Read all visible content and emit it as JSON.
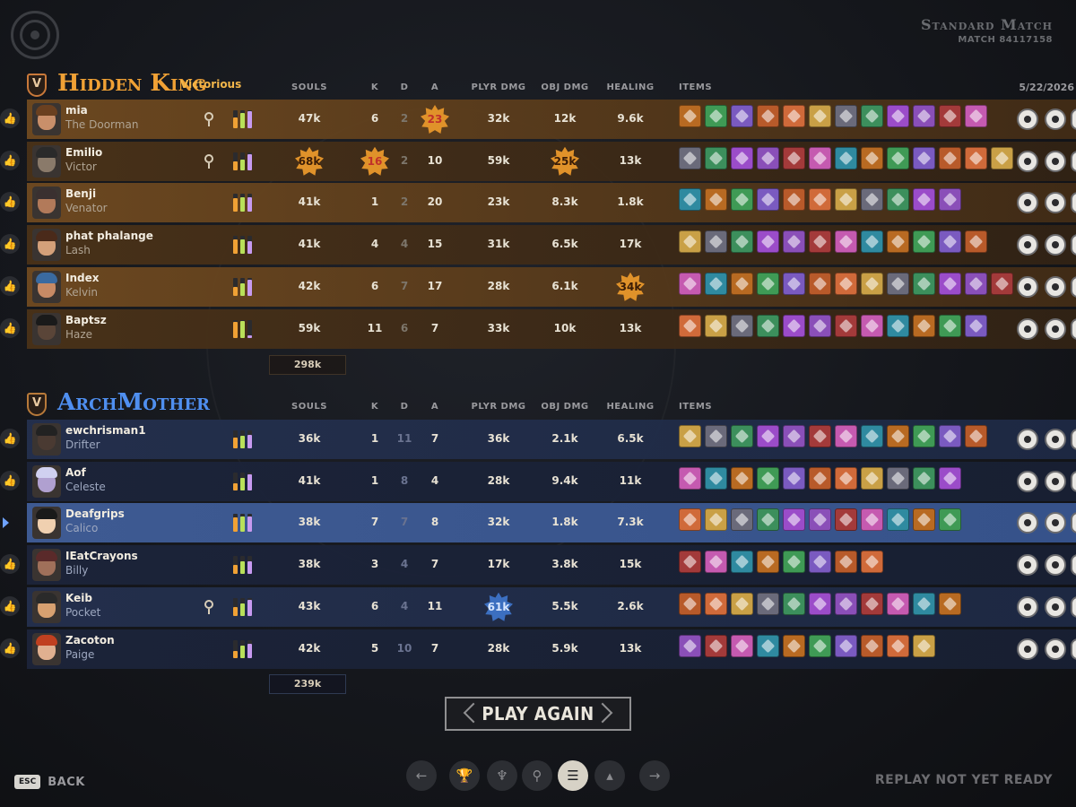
{
  "header": {
    "match_title": "Standard Match",
    "match_number": "MATCH 84117158",
    "date": "5/22/2026"
  },
  "columns": {
    "souls": "SOULS",
    "k": "K",
    "d": "D",
    "a": "A",
    "plyr_dmg": "PLYR DMG",
    "obj_dmg": "OBJ DMG",
    "healing": "HEALING",
    "items": "ITEMS"
  },
  "teams": [
    {
      "name": "Hidden King",
      "badge": "V",
      "status": "Victorious",
      "accent": "#f0a135",
      "total_souls": "298k",
      "players": [
        {
          "name": "mia",
          "hero": "The Doorman",
          "souls": "47k",
          "k": "6",
          "d": "2",
          "a": "23",
          "plyr_dmg": "32k",
          "obj_dmg": "12k",
          "healing": "9.6k",
          "highlight": "a",
          "role_icon": "keyhole-icon",
          "bars": [
            0.6,
            0.85,
            0.95
          ]
        },
        {
          "name": "Emilio",
          "hero": "Victor",
          "souls": "68k",
          "k": "16",
          "d": "2",
          "a": "10",
          "plyr_dmg": "59k",
          "obj_dmg": "25k",
          "healing": "13k",
          "highlight": "souls,k,obj_dmg",
          "role_icon": "sun-icon",
          "bars": [
            0.5,
            0.6,
            0.9
          ]
        },
        {
          "name": "Benji",
          "hero": "Venator",
          "souls": "41k",
          "k": "1",
          "d": "2",
          "a": "20",
          "plyr_dmg": "23k",
          "obj_dmg": "8.3k",
          "healing": "1.8k",
          "highlight": "",
          "role_icon": "",
          "bars": [
            0.75,
            0.8,
            0.8
          ]
        },
        {
          "name": "phat phalange",
          "hero": "Lash",
          "souls": "41k",
          "k": "4",
          "d": "4",
          "a": "15",
          "plyr_dmg": "31k",
          "obj_dmg": "6.5k",
          "healing": "17k",
          "highlight": "",
          "role_icon": "",
          "bars": [
            0.8,
            0.8,
            0.7
          ]
        },
        {
          "name": "Index",
          "hero": "Kelvin",
          "souls": "42k",
          "k": "6",
          "d": "7",
          "a": "17",
          "plyr_dmg": "28k",
          "obj_dmg": "6.1k",
          "healing": "34k",
          "highlight": "healing",
          "role_icon": "",
          "bars": [
            0.5,
            0.7,
            0.9
          ]
        },
        {
          "name": "Baptsz",
          "hero": "Haze",
          "souls": "59k",
          "k": "11",
          "d": "6",
          "a": "7",
          "plyr_dmg": "33k",
          "obj_dmg": "10k",
          "healing": "13k",
          "highlight": "",
          "role_icon": "",
          "bars": [
            0.9,
            0.95,
            0.15
          ]
        }
      ]
    },
    {
      "name": "ArchMother",
      "badge": "V",
      "status": "",
      "accent": "#4f8ff0",
      "total_souls": "239k",
      "players": [
        {
          "name": "ewchrisman1",
          "hero": "Drifter",
          "souls": "36k",
          "k": "1",
          "d": "11",
          "a": "7",
          "plyr_dmg": "36k",
          "obj_dmg": "2.1k",
          "healing": "6.5k",
          "highlight": "",
          "role_icon": "",
          "bars": [
            0.6,
            0.7,
            0.75
          ]
        },
        {
          "name": "Aof",
          "hero": "Celeste",
          "souls": "41k",
          "k": "1",
          "d": "8",
          "a": "4",
          "plyr_dmg": "28k",
          "obj_dmg": "9.4k",
          "healing": "11k",
          "highlight": "",
          "role_icon": "",
          "bars": [
            0.4,
            0.7,
            0.9
          ]
        },
        {
          "name": "Deafgrips",
          "hero": "Calico",
          "souls": "38k",
          "k": "7",
          "d": "7",
          "a": "8",
          "plyr_dmg": "32k",
          "obj_dmg": "1.8k",
          "healing": "7.3k",
          "highlight": "",
          "role_icon": "",
          "bars": [
            0.8,
            0.85,
            0.85
          ],
          "selected": true
        },
        {
          "name": "IEatCrayons",
          "hero": "Billy",
          "souls": "38k",
          "k": "3",
          "d": "4",
          "a": "7",
          "plyr_dmg": "17k",
          "obj_dmg": "3.8k",
          "healing": "15k",
          "highlight": "",
          "role_icon": "",
          "bars": [
            0.5,
            0.7,
            0.7
          ]
        },
        {
          "name": "Keib",
          "hero": "Pocket",
          "souls": "43k",
          "k": "6",
          "d": "4",
          "a": "11",
          "plyr_dmg": "61k",
          "obj_dmg": "5.5k",
          "healing": "2.6k",
          "highlight": "plyr_dmg",
          "role_icon": "keyhole-icon",
          "bars": [
            0.5,
            0.7,
            0.9
          ]
        },
        {
          "name": "Zacoton",
          "hero": "Paige",
          "souls": "42k",
          "k": "5",
          "d": "10",
          "a": "7",
          "plyr_dmg": "28k",
          "obj_dmg": "5.9k",
          "healing": "13k",
          "highlight": "",
          "role_icon": "",
          "bars": [
            0.4,
            0.7,
            0.8
          ]
        }
      ]
    }
  ],
  "footer": {
    "play_again": "PLAY AGAIN",
    "esc_key": "ESC",
    "back": "BACK",
    "replay": "REPLAY NOT YET READY",
    "nav_icons": [
      "arrow-left-icon",
      "trophy-icon",
      "team-icon",
      "key-icon",
      "list-icon",
      "chart-icon",
      "arrow-right-icon"
    ],
    "active_nav": "list-icon"
  }
}
